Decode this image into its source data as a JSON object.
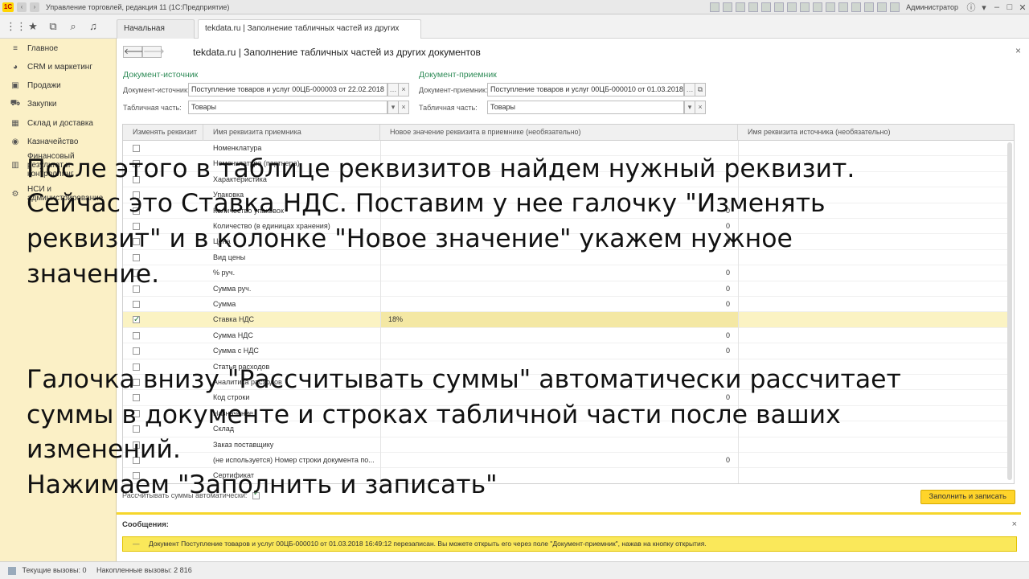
{
  "window": {
    "title": "Управление торговлей, редакция 11  (1С:Предприятие)",
    "user": "Администратор",
    "logo_text": "1С"
  },
  "toolbar": {
    "tabs": [
      {
        "label": "Начальная страница"
      },
      {
        "label": "tekdata.ru | Заполнение табличных частей из других документов"
      }
    ]
  },
  "sidebar": {
    "items": [
      {
        "label": "Главное",
        "icon": "menu-lines-icon"
      },
      {
        "label": "CRM и маркетинг",
        "icon": "crm-icon"
      },
      {
        "label": "Продажи",
        "icon": "sales-icon"
      },
      {
        "label": "Закупки",
        "icon": "cart-icon"
      },
      {
        "label": "Склад и доставка",
        "icon": "warehouse-icon"
      },
      {
        "label": "Казначейство",
        "icon": "treasury-icon"
      },
      {
        "label": "Финансовый результат и контроллинг",
        "icon": "chart-icon"
      },
      {
        "label": "НСИ и администрирование",
        "icon": "gear-icon"
      }
    ]
  },
  "form": {
    "title": "tekdata.ru | Заполнение табличных частей из других документов",
    "source": {
      "group_title": "Документ-источник",
      "doc_label": "Документ-источник:",
      "doc_value": "Поступление товаров и услуг 00ЦБ-000003 от 22.02.2018",
      "tab_label": "Табличная часть:",
      "tab_value": "Товары"
    },
    "target": {
      "group_title": "Документ-приемник",
      "doc_label": "Документ-приемник:",
      "doc_value": "Поступление товаров и услуг 00ЦБ-000010 от 01.03.2018",
      "tab_label": "Табличная часть:",
      "tab_value": "Товары"
    },
    "table": {
      "headers": [
        "Изменять реквизит",
        "Имя реквизита приемника",
        "Новое значение реквизита в приемнике (необязательно)",
        "Имя реквизита источника (необязательно)"
      ],
      "rows": [
        {
          "name": "Номенклатура",
          "checked": false,
          "value": "",
          "num": ""
        },
        {
          "name": "Номенклатура (партнера)",
          "checked": false,
          "value": "",
          "num": ""
        },
        {
          "name": "Характеристика",
          "checked": false,
          "value": "",
          "num": ""
        },
        {
          "name": "Упаковка",
          "checked": false,
          "value": "",
          "num": ""
        },
        {
          "name": "Количество упаковок",
          "checked": false,
          "value": "",
          "num": "0"
        },
        {
          "name": "Количество (в единицах хранения)",
          "checked": false,
          "value": "",
          "num": "0"
        },
        {
          "name": "Цена",
          "checked": false,
          "value": "",
          "num": "0"
        },
        {
          "name": "Вид цены",
          "checked": false,
          "value": "",
          "num": ""
        },
        {
          "name": "% руч.",
          "checked": false,
          "value": "",
          "num": "0"
        },
        {
          "name": "Сумма руч.",
          "checked": false,
          "value": "",
          "num": "0"
        },
        {
          "name": "Сумма",
          "checked": false,
          "value": "",
          "num": "0"
        },
        {
          "name": "Ставка НДС",
          "checked": true,
          "value": "18%",
          "num": ""
        },
        {
          "name": "Сумма НДС",
          "checked": false,
          "value": "",
          "num": "0"
        },
        {
          "name": "Сумма с НДС",
          "checked": false,
          "value": "",
          "num": "0"
        },
        {
          "name": "Статья расходов",
          "checked": false,
          "value": "",
          "num": ""
        },
        {
          "name": "Аналитика расходов",
          "checked": false,
          "value": "",
          "num": ""
        },
        {
          "name": "Код строки",
          "checked": false,
          "value": "",
          "num": "0"
        },
        {
          "name": "Назначение",
          "checked": false,
          "value": "",
          "num": ""
        },
        {
          "name": "Склад",
          "checked": false,
          "value": "",
          "num": ""
        },
        {
          "name": "Заказ поставщику",
          "checked": false,
          "value": "",
          "num": ""
        },
        {
          "name": "(не используется) Номер строки документа по...",
          "checked": false,
          "value": "",
          "num": "0"
        },
        {
          "name": "Сертификат",
          "checked": false,
          "value": "",
          "num": ""
        }
      ]
    },
    "calc_label": "Рассчитывать суммы автоматически:",
    "fill_button": "Заполнить и записать",
    "messages_title": "Сообщения:",
    "message_text": "Документ Поступление товаров и услуг 00ЦБ-000010 от 01.03.2018 16:49:12 перезаписан. Вы можете открыть его через поле \"Документ-приемник\", нажав на кнопку открытия."
  },
  "statusbar": {
    "current_calls": "Текущие вызовы: 0",
    "accumulated_calls": "Накопленные вызовы: 2 816"
  },
  "overlay": {
    "block1": [
      "После этого в таблице реквизитов найдем нужный реквизит.",
      "Сейчас это Ставка НДС. Поставим у нее галочку \"Изменять",
      "реквизит\" и в колонке \"Новое значение\" укажем нужное",
      "значение."
    ],
    "block2": [
      "Галочка внизу \"Рассчитывать суммы\" автоматически рассчитает",
      "суммы в документе и строках табличной части после ваших",
      "изменений.",
      "Нажимаем \"Заполнить и записать\""
    ]
  },
  "colors": {
    "sidebar_bg": "#fbf0c6",
    "accent_green": "#2e8b57",
    "button_yellow": "#ffd42a",
    "selected_row": "#fbf3c3"
  }
}
